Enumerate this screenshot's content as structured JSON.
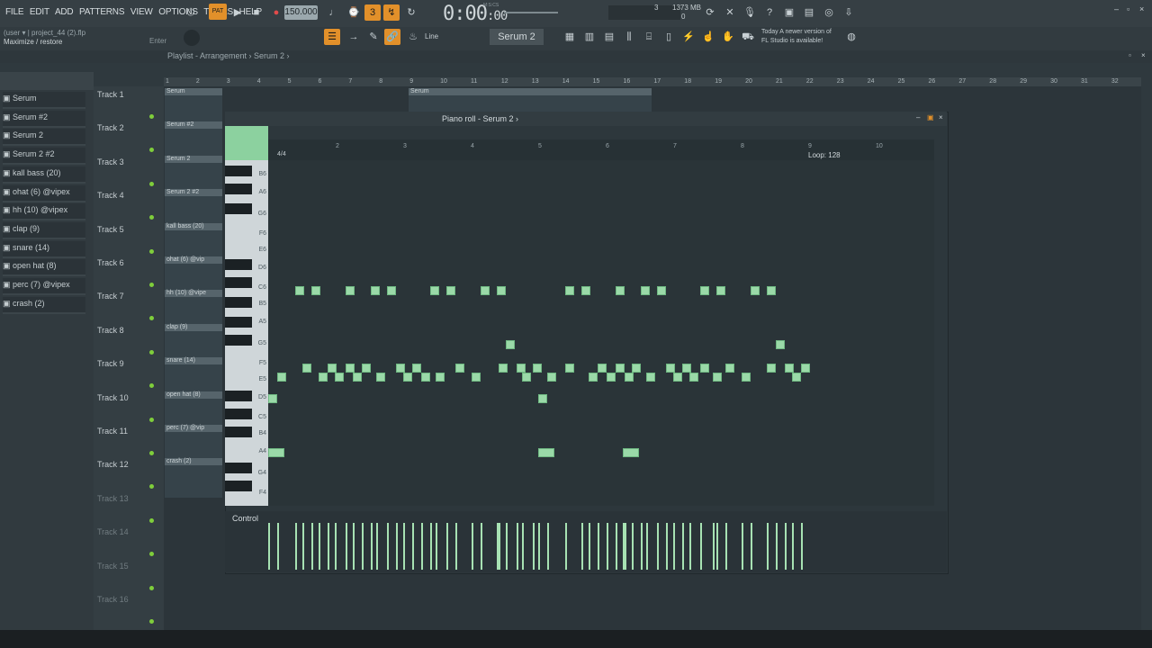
{
  "menu": {
    "items": [
      "FILE",
      "EDIT",
      "ADD",
      "PATTERNS",
      "VIEW",
      "OPTIONS",
      "TOOLS",
      "HELP"
    ]
  },
  "transport": {
    "bpm": "150.000",
    "time": "0:00",
    "time_small": ":00",
    "time_unit": "M:S:CS",
    "memory": "1373 MB",
    "cpu_top": "3",
    "cpu_bot": "0"
  },
  "hint": {
    "project": "(user ▾ | project_44 (2).flp",
    "text": "Maximize / restore",
    "enter": "Enter"
  },
  "pattern": {
    "name": "Serum 2",
    "tool": "Line"
  },
  "news": {
    "line1": "Today  A newer version of",
    "line2": "FL Studio is available!"
  },
  "playlist": {
    "title": "Playlist - Arrangement › Serum 2 ›"
  },
  "channels": [
    "Serum",
    "Serum #2",
    "Serum 2",
    "Serum 2 #2",
    "kall bass (20)",
    "ohat (6) @vipex",
    "hh (10) @vipex",
    "clap (9)",
    "snare (14)",
    "open hat (8)",
    "perc (7) @vipex",
    "crash (2)"
  ],
  "tracks": [
    "Track 1",
    "Track 2",
    "Track 3",
    "Track 4",
    "Track 5",
    "Track 6",
    "Track 7",
    "Track 8",
    "Track 9",
    "Track 10",
    "Track 11",
    "Track 12",
    "Track 13",
    "Track 14",
    "Track 15",
    "Track 16"
  ],
  "clips": [
    "Serum",
    "Serum #2",
    "Serum 2",
    "Serum 2 #2",
    "kall bass (20)",
    "ohat (6) @vip",
    "hh (10) @vipe",
    "clap (9)",
    "snare (14)",
    "open hat (8)",
    "perc (7) @vip",
    "crash (2)",
    "Serum"
  ],
  "ruler": [
    "1",
    "2",
    "3",
    "4",
    "5",
    "6",
    "7",
    "8",
    "9",
    "10",
    "11",
    "12",
    "13",
    "14",
    "15",
    "16",
    "17",
    "18",
    "19",
    "20",
    "21",
    "22",
    "23",
    "24",
    "25",
    "26",
    "27",
    "28",
    "29",
    "30",
    "31",
    "32"
  ],
  "pianoroll": {
    "title": "Piano roll - Serum 2 ›",
    "timesig": "4/4",
    "loop": "Loop: 128",
    "ruler": [
      "2",
      "3",
      "4",
      "5",
      "6",
      "7",
      "8",
      "9",
      "10"
    ],
    "keys": [
      "B6",
      "A6",
      "G6",
      "F6",
      "E6",
      "D6",
      "C6",
      "B5",
      "A5",
      "G5",
      "F5",
      "E5",
      "D5",
      "C5",
      "B4",
      "A4",
      "G4",
      "F4"
    ],
    "control_label": "Control"
  }
}
